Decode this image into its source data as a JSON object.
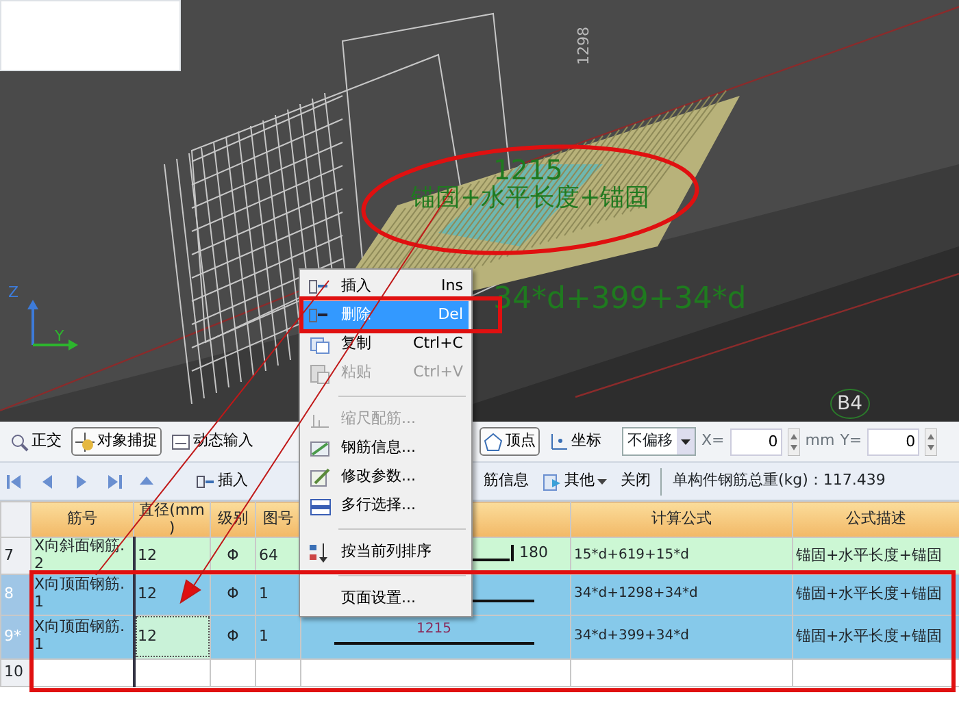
{
  "viewport": {
    "axis_labels": [
      "Z",
      "Y"
    ],
    "dimension": "1298",
    "labels": [
      "1215",
      "锚固+水平长度+锚固",
      "34*d+399+34*d"
    ],
    "marker": "B4"
  },
  "snap_toolbar": [
    {
      "kind": "toggle",
      "label": "正交",
      "pressed": false
    },
    {
      "kind": "toggle",
      "label": "对象捕捉",
      "pressed": true
    },
    {
      "kind": "toggle",
      "label": "动态输入",
      "pressed": false
    },
    {
      "kind": "gap"
    },
    {
      "kind": "toggle",
      "label": "顶点",
      "pressed": true
    },
    {
      "kind": "toggle",
      "label": "坐标",
      "pressed": false
    },
    {
      "kind": "dropdown",
      "value": "不偏移"
    },
    {
      "kind": "field",
      "label": "X=",
      "value": "0",
      "unit": "mm"
    },
    {
      "kind": "field",
      "label": "Y=",
      "value": "0"
    }
  ],
  "table_toolbar": {
    "insert": "插入",
    "items": [
      "筋信息",
      "其他"
    ],
    "close": "关闭",
    "total": "单构件钢筋总重(kg)：117.439"
  },
  "table": {
    "columns": [
      {
        "kind": "index"
      },
      {
        "label": "筋号"
      },
      {
        "label": "直径(mm)"
      },
      {
        "label": "级别"
      },
      {
        "label": "图号"
      },
      {
        "kind": "graphic"
      },
      {
        "label": "计算公式"
      },
      {
        "label": "公式描述"
      }
    ],
    "rows": [
      {
        "number": "7",
        "bar": "X向斜面钢筋.2",
        "diameter": "12",
        "grade": "Φ",
        "figure": "64",
        "kind": "hook",
        "shape_label": "180",
        "formula": "15*d+619+15*d",
        "description": "锚固+水平长度+锚固",
        "selected": false,
        "editing": false
      },
      {
        "number": "8",
        "bar": "X向顶面钢筋.1",
        "diameter": "12",
        "grade": "Φ",
        "figure": "1",
        "kind": "straight",
        "formula": "34*d+1298+34*d",
        "description": "锚固+水平长度+锚固",
        "selected": true,
        "editing": false
      },
      {
        "number": "9*",
        "bar": "X向顶面钢筋.1",
        "diameter": "12",
        "grade": "Φ",
        "figure": "1",
        "kind": "straight",
        "shape_label": "1215",
        "formula": "34*d+399+34*d",
        "description": "锚固+水平长度+锚固",
        "selected": true,
        "editing": true
      },
      {
        "number": "10",
        "selected": false,
        "editing": false
      }
    ]
  },
  "context_menu": [
    {
      "kind": "item",
      "label": "插入",
      "shortcut": "Ins",
      "selected": false,
      "disabled": false
    },
    {
      "kind": "item",
      "label": "删除",
      "shortcut": "Del",
      "selected": true,
      "disabled": false
    },
    {
      "kind": "item",
      "label": "复制",
      "shortcut": "Ctrl+C",
      "selected": false,
      "disabled": false
    },
    {
      "kind": "item",
      "label": "粘贴",
      "shortcut": "Ctrl+V",
      "selected": false,
      "disabled": true
    },
    {
      "kind": "separator"
    },
    {
      "kind": "item",
      "label": "缩尺配筋...",
      "selected": false,
      "disabled": true
    },
    {
      "kind": "item",
      "label": "钢筋信息...",
      "selected": false,
      "disabled": false
    },
    {
      "kind": "item",
      "label": "修改参数...",
      "selected": false,
      "disabled": false
    },
    {
      "kind": "item",
      "label": "多行选择...",
      "selected": false,
      "disabled": false
    },
    {
      "kind": "separator"
    },
    {
      "kind": "item",
      "label": "按当前列排序",
      "selected": false,
      "disabled": false
    },
    {
      "kind": "separator"
    },
    {
      "kind": "item",
      "label": "页面设置...",
      "selected": false,
      "disabled": false
    }
  ]
}
